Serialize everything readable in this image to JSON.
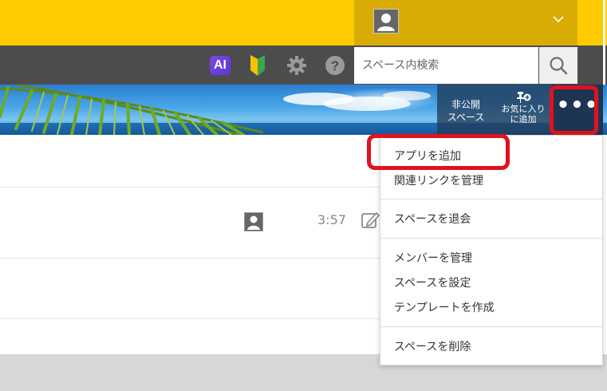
{
  "header": {
    "search_placeholder": "スペース内検索"
  },
  "icons": {
    "ai_label": "AI"
  },
  "cover": {
    "private_line1": "非公開",
    "private_line2": "スペース",
    "favorite_line1": "お気に入り",
    "favorite_line2": "に追加",
    "more_label": "•••"
  },
  "post": {
    "time": "3:57"
  },
  "menu": {
    "add_app": "アプリを追加",
    "manage_links": "関連リンクを管理",
    "leave_space": "スペースを退会",
    "manage_members": "メンバーを管理",
    "space_settings": "スペースを設定",
    "create_template": "テンプレートを作成",
    "delete_space": "スペースを削除"
  },
  "colors": {
    "topbar": "#ffcb00",
    "user_menu": "#d9ac05",
    "globalbar": "#4c4c4c",
    "highlight": "#e0121e",
    "ai_badge": "#6a3fe0"
  }
}
